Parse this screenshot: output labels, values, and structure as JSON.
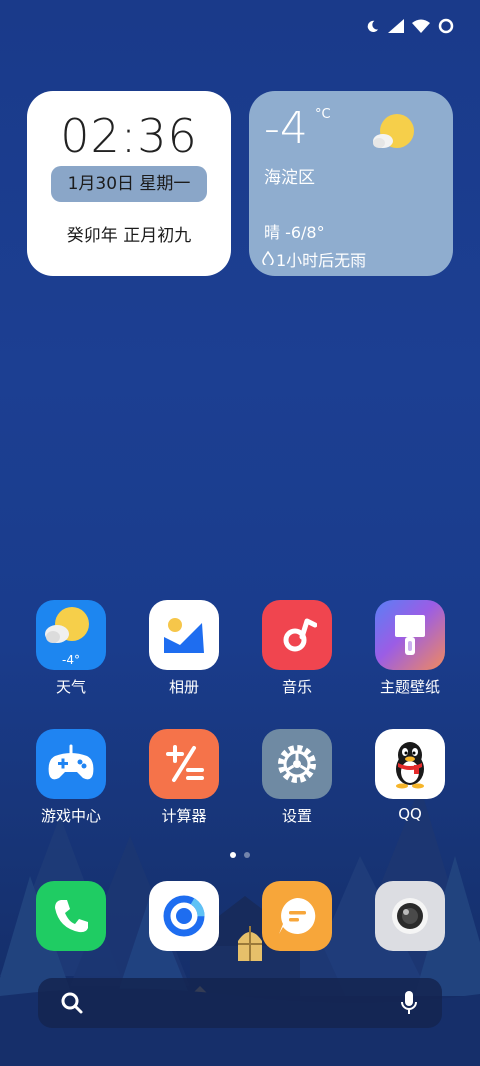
{
  "status_bar": {
    "icons": [
      "moon-icon",
      "signal-icon",
      "wifi-icon",
      "circle-icon"
    ]
  },
  "clock_widget": {
    "time": "02:36",
    "date": "1月30日 星期一",
    "lunar": "癸卯年 正月初九"
  },
  "weather_widget": {
    "temp": "-4",
    "unit": "°C",
    "location": "海淀区",
    "condition": "晴 -6/8°",
    "rain": "1小时后无雨"
  },
  "apps": [
    {
      "label": "天气",
      "icon": "weather-icon",
      "badge": "-4°"
    },
    {
      "label": "相册",
      "icon": "gallery-icon"
    },
    {
      "label": "音乐",
      "icon": "music-icon"
    },
    {
      "label": "主题壁纸",
      "icon": "themes-icon"
    },
    {
      "label": "游戏中心",
      "icon": "game-center-icon"
    },
    {
      "label": "计算器",
      "icon": "calculator-icon"
    },
    {
      "label": "设置",
      "icon": "settings-icon"
    },
    {
      "label": "QQ",
      "icon": "qq-icon"
    }
  ],
  "dock": [
    {
      "name": "phone",
      "icon": "phone-icon"
    },
    {
      "name": "browser",
      "icon": "browser-icon"
    },
    {
      "name": "messages",
      "icon": "messages-icon"
    },
    {
      "name": "camera",
      "icon": "camera-icon"
    }
  ],
  "page_indicator": {
    "pages": 2,
    "current": 1
  },
  "search_bar": {
    "icons": [
      "search-icon",
      "microphone-icon"
    ]
  },
  "colors": {
    "weather_bg": "#8fadcf",
    "date_pill": "#8aa6c8",
    "gallery": "#ffffff",
    "music": "#f0454f",
    "game": "#1f84f2",
    "calculator": "#f5734a",
    "settings": "#6f8aa3",
    "phone": "#1fcc63",
    "messages": "#f7a63a"
  }
}
